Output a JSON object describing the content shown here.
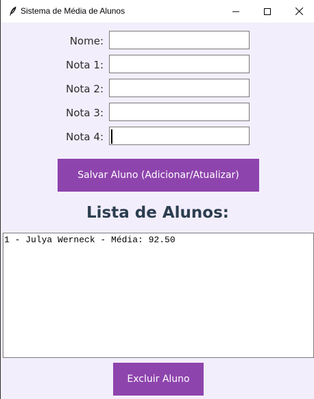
{
  "window": {
    "title": "Sistema de Média de Alunos",
    "icon": "feather-icon"
  },
  "form": {
    "fields": [
      {
        "label": "Nome:",
        "value": "",
        "name": "nome"
      },
      {
        "label": "Nota 1:",
        "value": "",
        "name": "nota1"
      },
      {
        "label": "Nota 2:",
        "value": "",
        "name": "nota2"
      },
      {
        "label": "Nota 3:",
        "value": "",
        "name": "nota3"
      },
      {
        "label": "Nota 4:",
        "value": "",
        "name": "nota4"
      }
    ],
    "save_label": "Salvar Aluno (Adicionar/Atualizar)"
  },
  "list": {
    "title": "Lista de Alunos:",
    "items": [
      "1 - Julya Werneck - Média: 92.50"
    ]
  },
  "actions": {
    "delete_label": "Excluir Aluno"
  },
  "colors": {
    "background": "#f3eefc",
    "button": "#8e44ad",
    "heading": "#2c3e50"
  }
}
